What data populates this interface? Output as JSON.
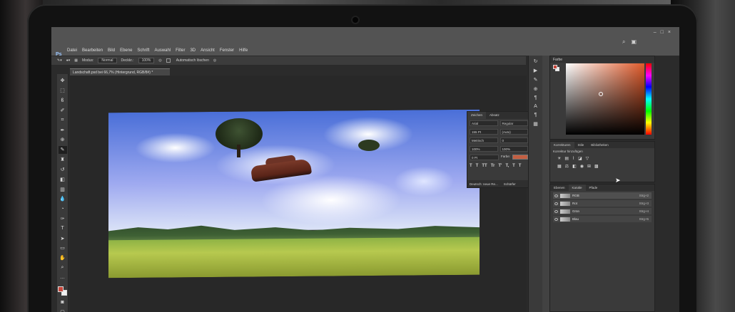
{
  "app": {
    "logo": "Ps",
    "menu": [
      "Datei",
      "Bearbeiten",
      "Bild",
      "Ebene",
      "Schrift",
      "Auswahl",
      "Filter",
      "3D",
      "Ansicht",
      "Fenster",
      "Hilfe"
    ],
    "window_controls": [
      "–",
      "□",
      "×"
    ]
  },
  "options_bar": {
    "modus_label": "Modus:",
    "modus_value": "Normal",
    "deckkraft_label": "Deckkr.:",
    "deckkraft_value": "100%",
    "auto_erase_label": "Automatisch löschen"
  },
  "document_tab": {
    "title": "Landschaft.psd bei 66,7% (Hintergrund, RGB/8#) *"
  },
  "character_panel": {
    "tabs": [
      "Zeichen",
      "Absatz"
    ],
    "font_family": "Arial",
    "font_style": "Regular",
    "font_size": "155 Pt",
    "leading": "(Auto)",
    "kerning": "Metrisch",
    "tracking": "0",
    "vertical_scale": "100%",
    "horizontal_scale": "100%",
    "baseline": "0 Pt",
    "color_label": "Farbe:",
    "style_buttons": [
      "T",
      "T",
      "TT",
      "Tr",
      "T'",
      "T,",
      "T",
      "T"
    ],
    "language": "Deutsch: neue Re...",
    "antialias": "Schärfer"
  },
  "color_panel": {
    "title": "Farbe",
    "foreground": "#c8463a",
    "background": "#eeeeee"
  },
  "adjustments_panel": {
    "tabs": [
      "Korrekturen",
      "Stile",
      "Bibliotheken"
    ],
    "label": "Korrektur hinzufügen"
  },
  "layers_panel": {
    "tabs": [
      "Ebenen",
      "Kanäle",
      "Pfade"
    ],
    "layers": [
      {
        "name": "RGB",
        "shortcut": "Strg+2"
      },
      {
        "name": "Rot",
        "shortcut": "Strg+3"
      },
      {
        "name": "Grün",
        "shortcut": "Strg+4"
      },
      {
        "name": "Blau",
        "shortcut": "Strg+5"
      }
    ]
  }
}
